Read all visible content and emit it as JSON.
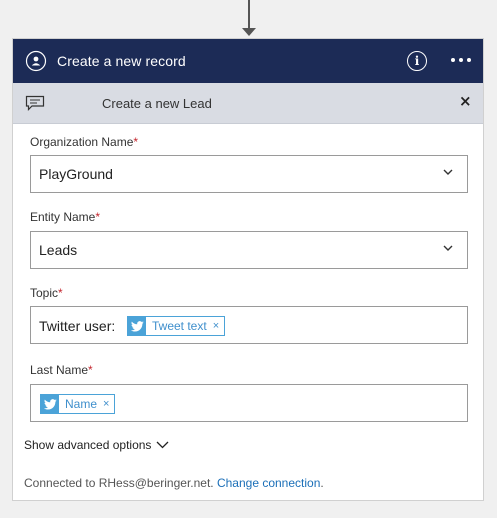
{
  "card": {
    "title": "Create a new record",
    "info_icon": "i",
    "sub_header": {
      "title": "Create a new Lead",
      "close_label": "×"
    }
  },
  "fields": {
    "organization": {
      "label": "Organization Name",
      "required_mark": "*",
      "value": "PlayGround"
    },
    "entity": {
      "label": "Entity Name",
      "required_mark": "*",
      "value": "Leads"
    },
    "topic": {
      "label": "Topic",
      "required_mark": "*",
      "prefix": "Twitter user:",
      "token": {
        "label": "Tweet text",
        "remove": "×",
        "icon": "twitter-icon"
      }
    },
    "last_name": {
      "label": "Last Name",
      "required_mark": "*",
      "token": {
        "label": "Name",
        "remove": "×",
        "icon": "twitter-icon"
      }
    }
  },
  "advanced": {
    "label": "Show advanced options"
  },
  "footer": {
    "connected_text": "Connected to RHess@beringer.net.",
    "change_link": "Change connection",
    "trailing": "."
  },
  "colors": {
    "header_bg": "#1c2b56",
    "subheader_bg": "#d9dce3",
    "token_blue": "#4ba3d8",
    "link": "#1b6fb8",
    "required": "#c4262e"
  }
}
